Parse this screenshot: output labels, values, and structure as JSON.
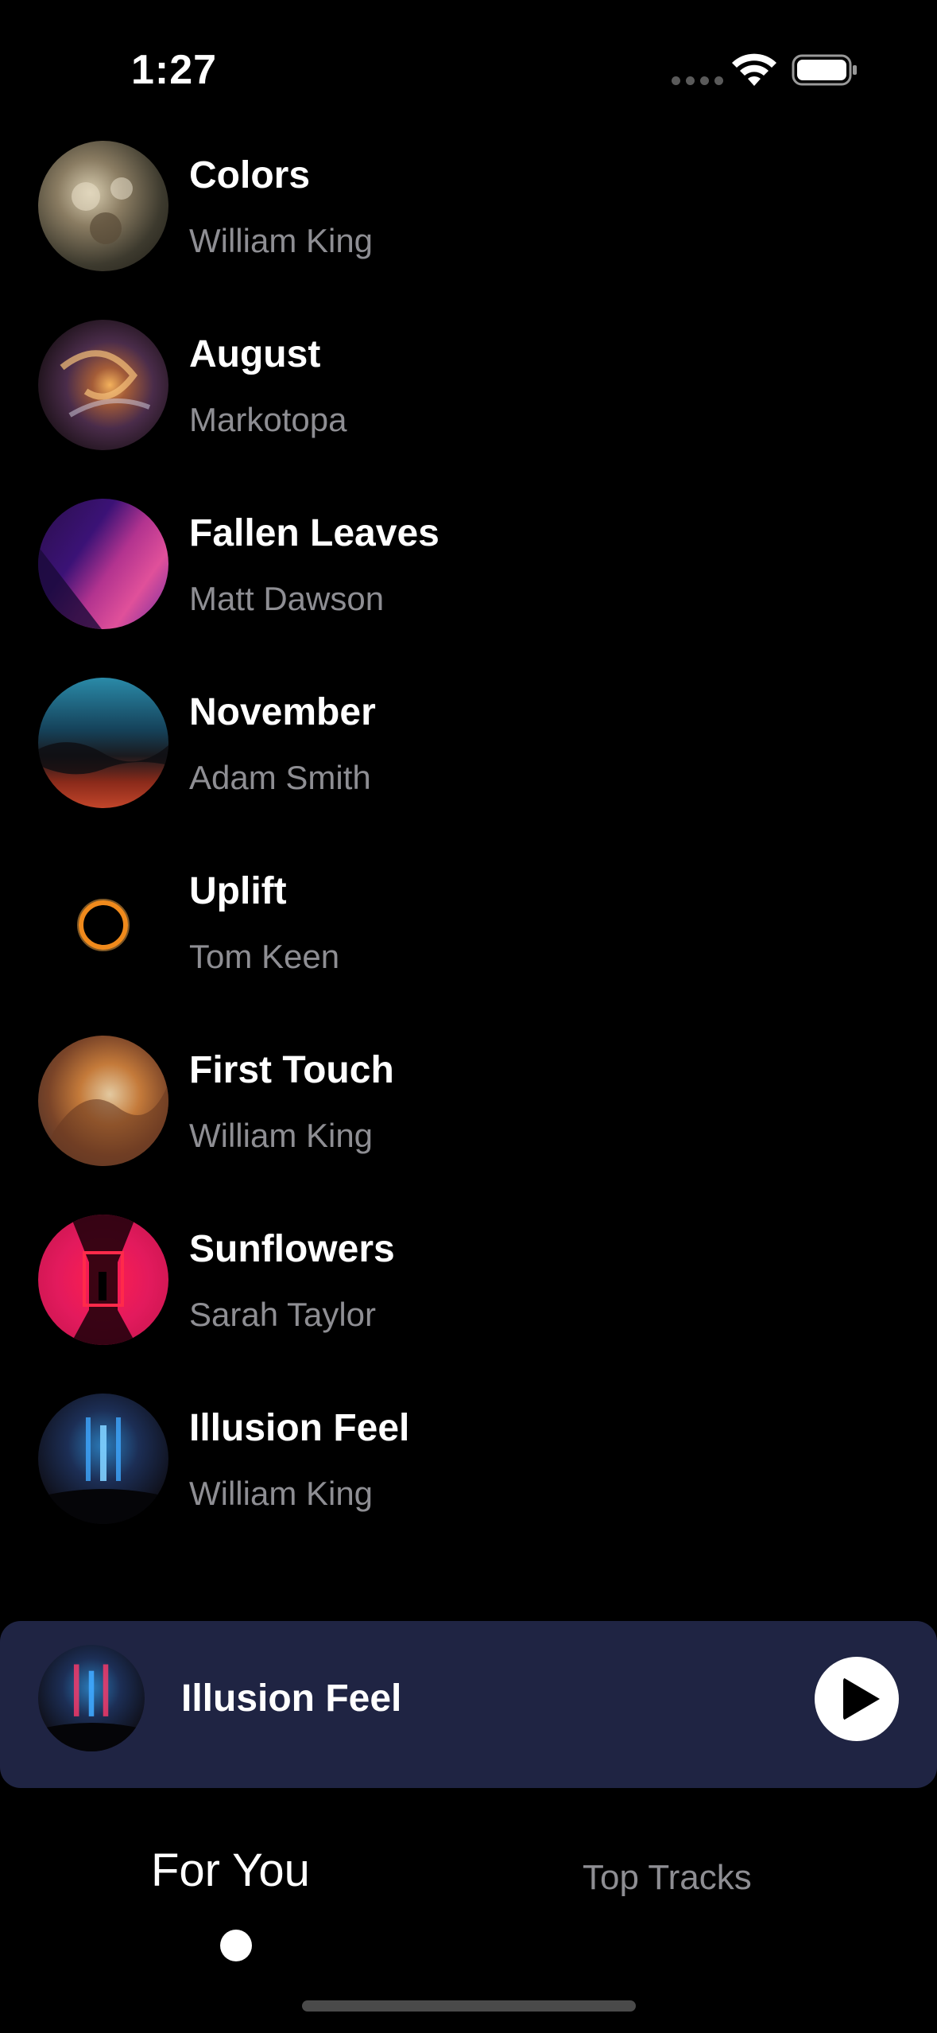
{
  "status_bar": {
    "time": "1:27",
    "icons": [
      "signal-dots-icon",
      "wifi-icon",
      "battery-icon"
    ]
  },
  "tracks": [
    {
      "title": "Colors",
      "artist": "William King"
    },
    {
      "title": "August",
      "artist": "Markotopa"
    },
    {
      "title": "Fallen Leaves",
      "artist": "Matt Dawson"
    },
    {
      "title": "November",
      "artist": "Adam Smith"
    },
    {
      "title": "Uplift",
      "artist": "Tom Keen"
    },
    {
      "title": "First Touch",
      "artist": "William King"
    },
    {
      "title": "Sunflowers",
      "artist": "Sarah Taylor"
    },
    {
      "title": "Illusion Feel",
      "artist": "William King"
    }
  ],
  "now_playing": {
    "title": "Illusion Feel",
    "control_icon": "play-icon",
    "background": "#1f2443"
  },
  "tabs": [
    {
      "label": "For You",
      "active": true
    },
    {
      "label": "Top Tracks",
      "active": false
    }
  ],
  "colors": {
    "background": "#000000",
    "primary_text": "#ffffff",
    "secondary_text": "#8e8e93"
  }
}
